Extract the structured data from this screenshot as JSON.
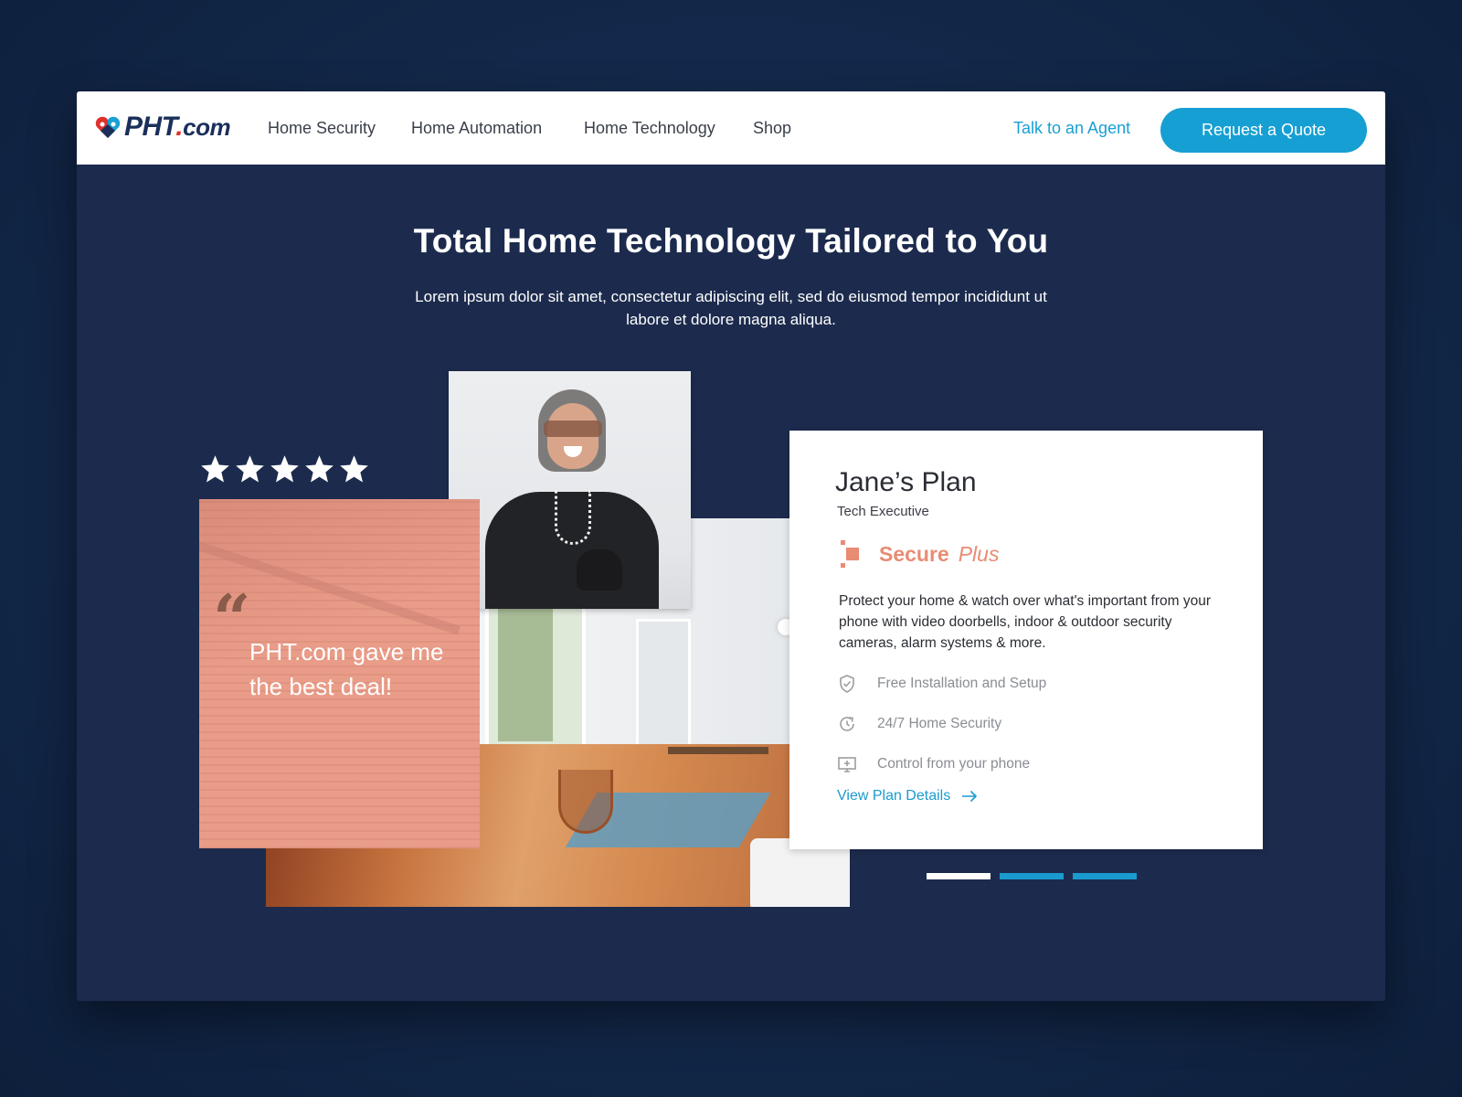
{
  "header": {
    "logo": {
      "brand": "PHT",
      "dot": ".",
      "tld": "com"
    },
    "nav": [
      {
        "label": "Home Security"
      },
      {
        "label": "Home Automation"
      },
      {
        "label": "Home Technology"
      },
      {
        "label": "Shop"
      }
    ],
    "agent_link": "Talk to an Agent",
    "quote_button": "Request a Quote"
  },
  "hero": {
    "title": "Total Home Technology Tailored to You",
    "subtitle": "Lorem ipsum dolor sit amet, consectetur adipiscing elit, sed do eiusmod tempor incididunt ut labore et dolore magna aliqua."
  },
  "testimonial": {
    "rating": 5,
    "rating_max": 5,
    "quote_mark": "“",
    "quote": "PHT.com gave me the best deal!"
  },
  "plan": {
    "name": "Jane’s Plan",
    "role": "Tech Executive",
    "tier_name": "Secure",
    "tier_suffix": "Plus",
    "description": "Protect your home & watch over what's important from your phone with video doorbells, indoor & outdoor security cameras, alarm systems & more.",
    "features": [
      {
        "icon": "shield-check-icon",
        "label": "Free Installation and Setup"
      },
      {
        "icon": "clock-refresh-icon",
        "label": "24/7 Home Security"
      },
      {
        "icon": "monitor-plus-icon",
        "label": "Control from your phone"
      }
    ],
    "link_label": "View Plan Details"
  },
  "carousel": {
    "slides": 3,
    "active_index": 0
  },
  "colors": {
    "background": "#142a4d",
    "panel": "#1c2b4d",
    "accent_blue": "#169fd3",
    "salmon": "#e99c88",
    "tier_color": "#e88c74",
    "logo_navy": "#1a2f5a",
    "logo_red": "#e0312b"
  }
}
